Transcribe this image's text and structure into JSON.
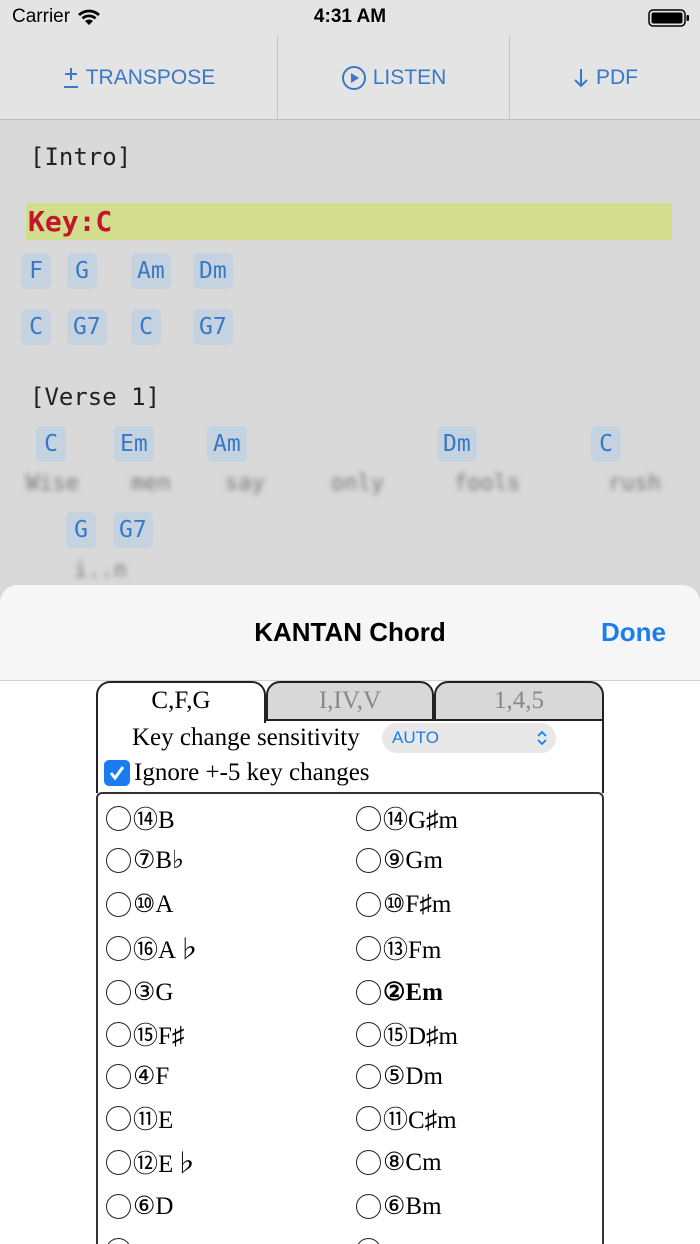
{
  "status": {
    "carrier": "Carrier",
    "time": "4:31 AM"
  },
  "toolbar": {
    "transpose": "TRANSPOSE",
    "listen": "LISTEN",
    "pdf": "PDF"
  },
  "sheet": {
    "intro_label": "[Intro]",
    "key_label": "Key:C",
    "intro_row1": [
      "F",
      "G",
      "Am",
      "Dm"
    ],
    "intro_row2": [
      "C",
      "G7",
      "C",
      "G7"
    ],
    "verse_label": "[Verse 1]",
    "verse_row1": [
      "C",
      "Em",
      "Am",
      "Dm",
      "C"
    ],
    "verse_lyrics1": [
      "Wise",
      "men",
      "say",
      "only",
      "fools",
      "rush"
    ],
    "verse_row2": [
      "G",
      "G7"
    ],
    "verse_lyrics2": [
      "i..n"
    ]
  },
  "modal": {
    "title": "KANTAN Chord",
    "done": "Done",
    "tabs": [
      "C,F,G",
      "I,IV,V",
      "1,4,5"
    ],
    "sensitivity_label": "Key change sensitivity",
    "sensitivity_value": "AUTO",
    "ignore_label": "Ignore +-5 key changes",
    "ignore_checked": true,
    "keys_left": [
      "⑭B",
      "⑦B♭",
      "⑩A",
      "⑯A♭",
      "③G",
      "⑮F♯",
      "④F",
      "⑪E",
      "⑫E♭",
      "⑥D"
    ],
    "keys_right": [
      "⑭G♯m",
      "⑨Gm",
      "⑩F♯m",
      "⑬Fm",
      "②Em",
      "⑮D♯m",
      "⑤Dm",
      "⑪C♯m",
      "⑧Cm",
      "⑥Bm"
    ],
    "highlighted_key": "②Em"
  },
  "colors": {
    "accent": "#1a7cf0",
    "chord_text": "#3978c7",
    "chord_bg": "#c5d3e1",
    "key_bar": "#d3dd8e",
    "key_text": "#c4162a"
  }
}
